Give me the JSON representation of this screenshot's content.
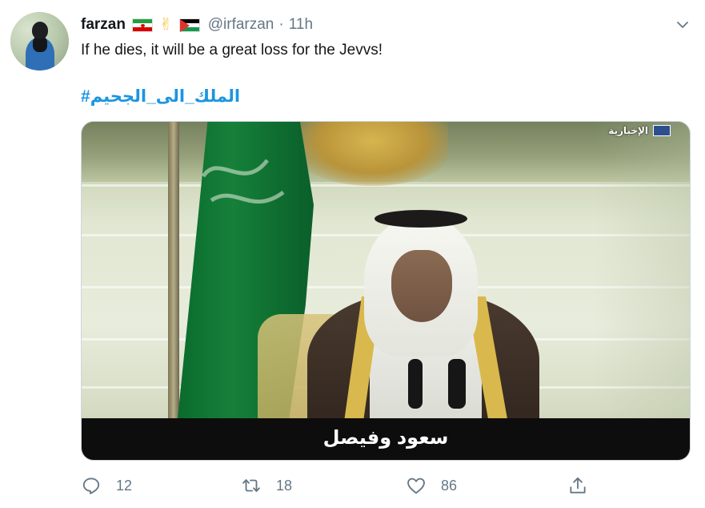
{
  "tweet": {
    "author_name": "farzan",
    "author_emojis": [
      "iran-flag-icon",
      "victory-hand-icon",
      "palestine-flag-icon"
    ],
    "handle": "@irfarzan",
    "separator": "·",
    "time": "11h",
    "text": "If he dies, it will be a great loss for the Jevvs!",
    "hashtag": "#الملك_الى_الجحيم",
    "media": {
      "caption": "سعود وفيصل",
      "channel_logo": "الإخبارية"
    },
    "actions": {
      "reply_count": "12",
      "retweet_count": "18",
      "like_count": "86"
    }
  },
  "colors": {
    "text_primary": "#14171a",
    "text_secondary": "#657786",
    "link": "#1b95e0"
  }
}
